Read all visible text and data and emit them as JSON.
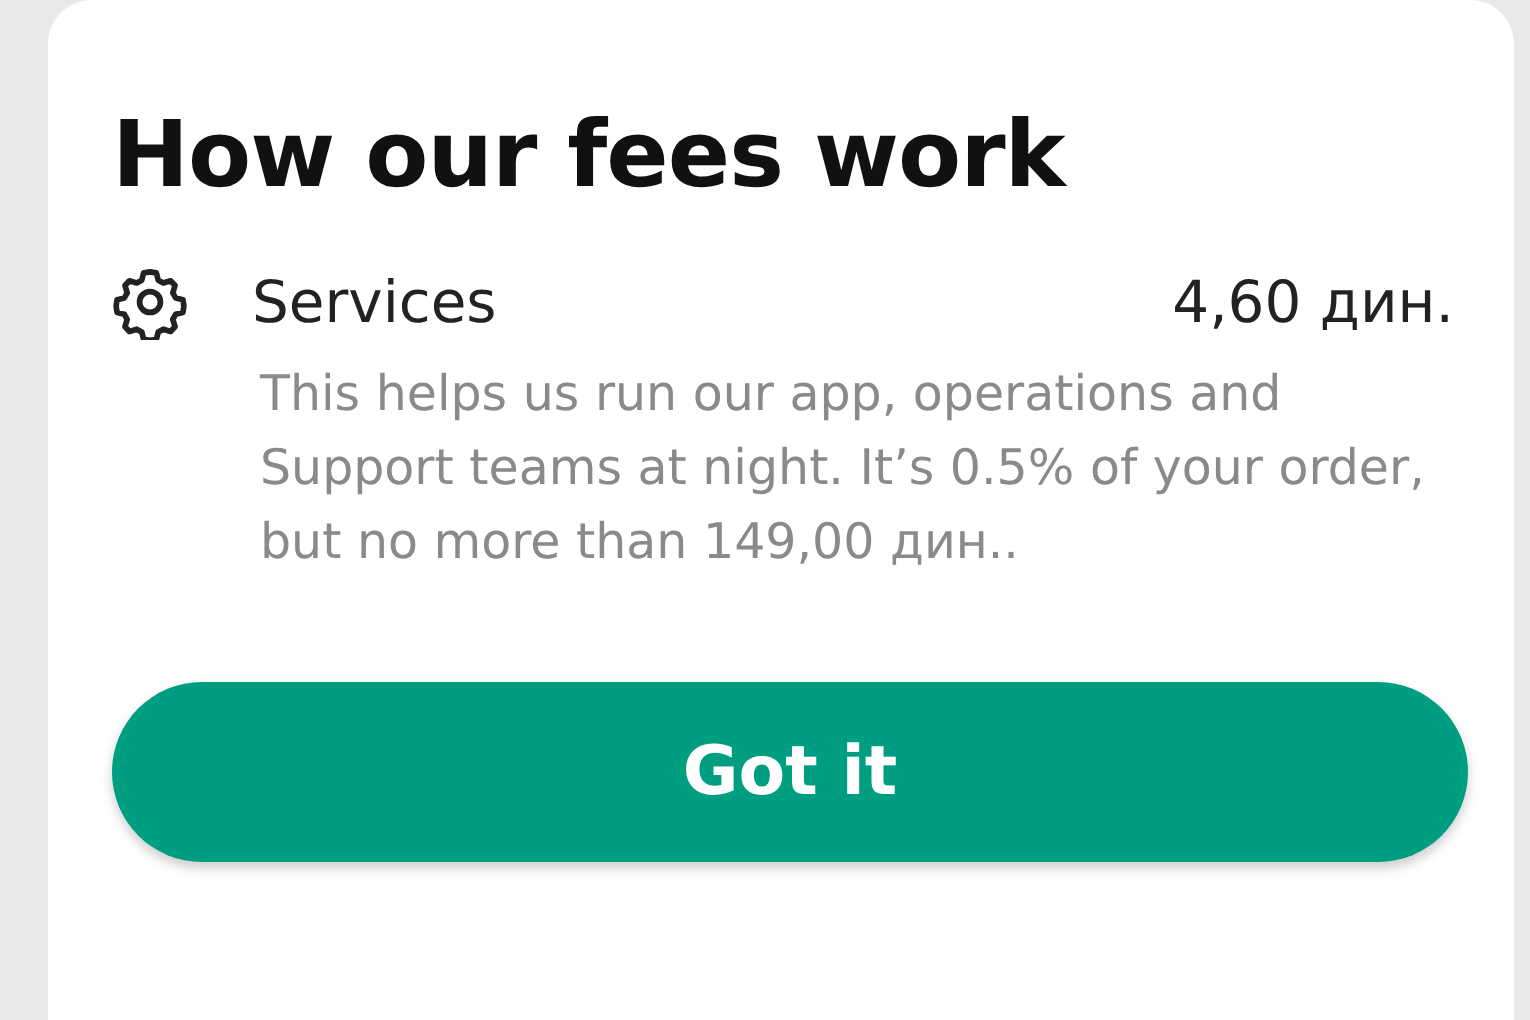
{
  "title": "How our fees work",
  "fees": [
    {
      "name": "Services",
      "amount": "4,60 дин.",
      "description": "This helps us run our app, operations and Support teams at night. It’s 0.5% of your order, but no more than 149,00 дин.."
    }
  ],
  "button": "Got it"
}
